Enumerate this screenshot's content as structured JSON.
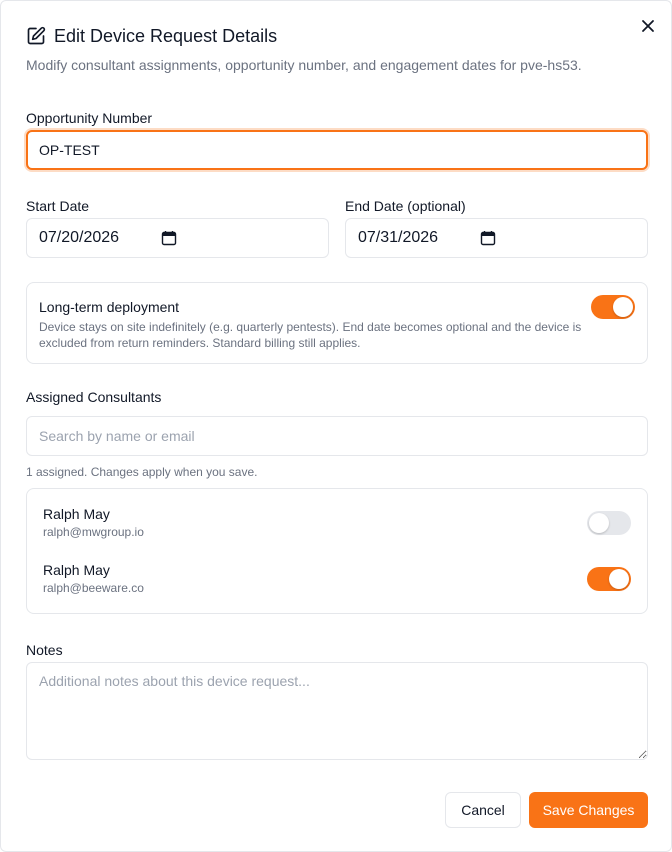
{
  "dialog": {
    "title": "Edit Device Request Details",
    "subtitle": "Modify consultant assignments, opportunity number, and engagement dates for pve-hs53.",
    "title_icon": "edit-icon",
    "close_icon": "close-icon"
  },
  "opportunity": {
    "label": "Opportunity Number",
    "value": "OP-TEST"
  },
  "start_date": {
    "label": "Start Date",
    "value": "07/20/2026",
    "icon": "calendar-icon"
  },
  "end_date": {
    "label": "End Date (optional)",
    "value": "07/31/2026",
    "icon": "calendar-icon"
  },
  "long_term": {
    "title": "Long-term deployment",
    "description": "Device stays on site indefinitely (e.g. quarterly pentests). End date becomes optional and the device is excluded from return reminders. Standard billing still applies.",
    "enabled": true
  },
  "consultants": {
    "label": "Assigned Consultants",
    "search_placeholder": "Search by name or email",
    "hint": "1 assigned. Changes apply when you save.",
    "items": [
      {
        "name": "Ralph May",
        "email": "ralph@mwgroup.io",
        "assigned": false
      },
      {
        "name": "Ralph May",
        "email": "ralph@beeware.co",
        "assigned": true
      }
    ]
  },
  "notes": {
    "label": "Notes",
    "placeholder": "Additional notes about this device request..."
  },
  "actions": {
    "cancel_label": "Cancel",
    "save_label": "Save Changes"
  },
  "colors": {
    "accent": "#f97316",
    "border": "#e5e7eb",
    "muted_text": "#6b7280"
  }
}
